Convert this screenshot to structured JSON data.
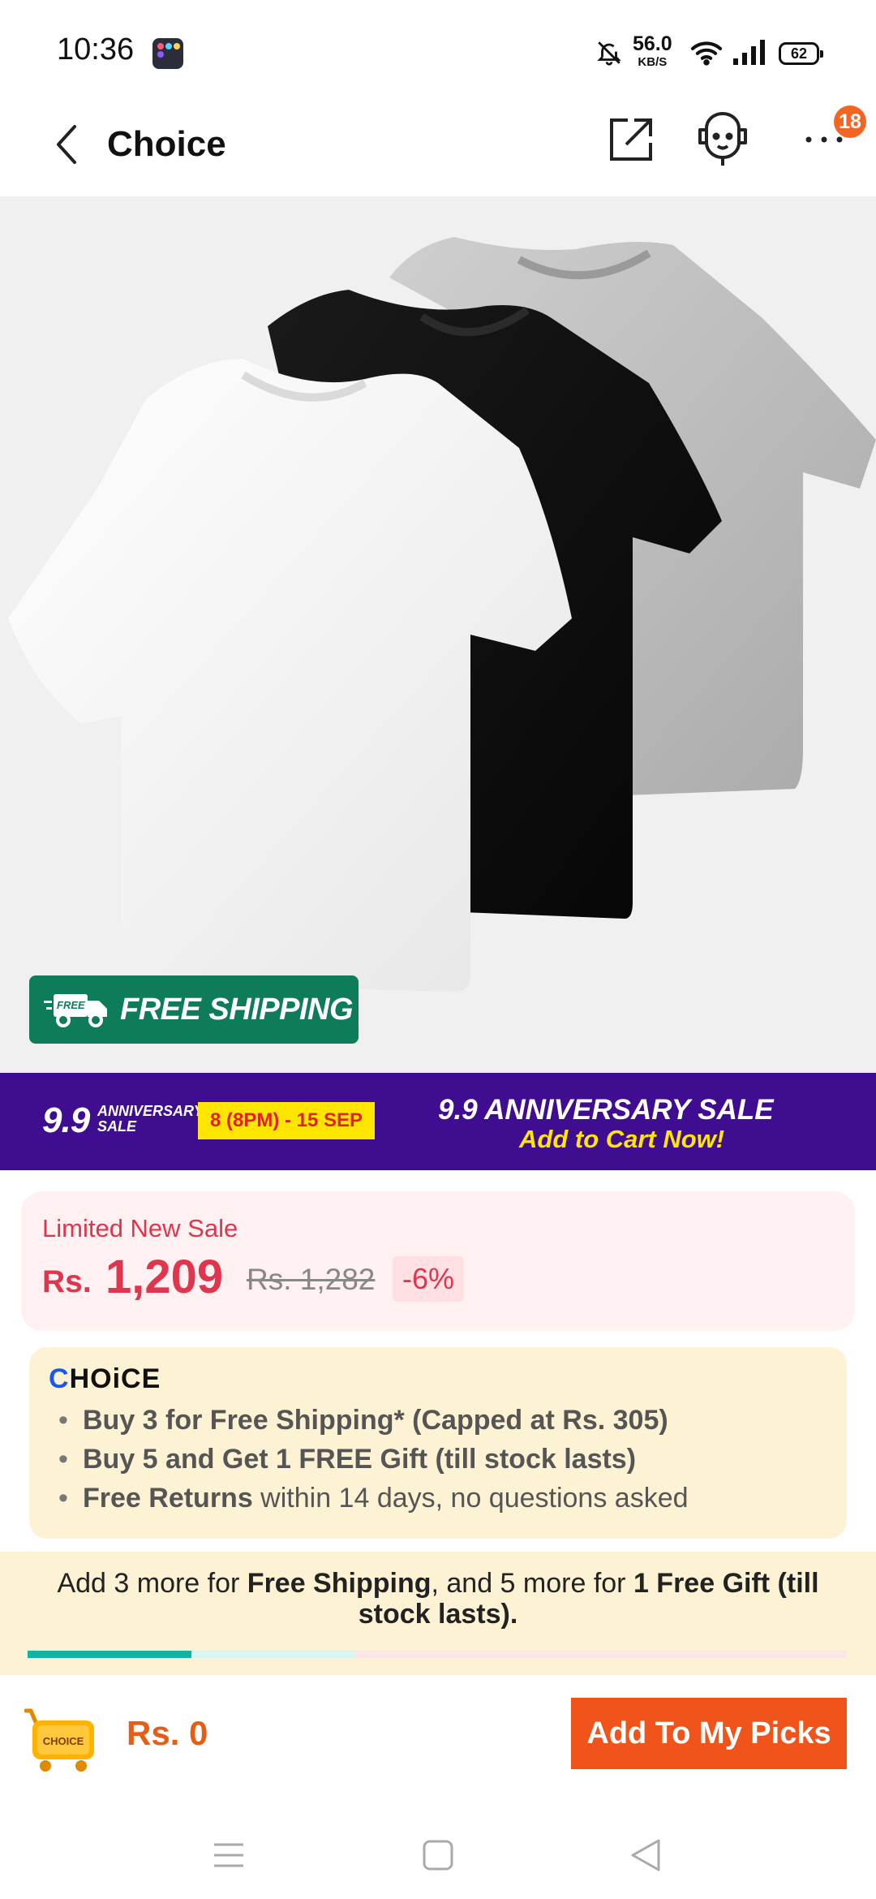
{
  "status_bar": {
    "time": "10:36",
    "net_speed_value": "56.0",
    "net_speed_unit": "KB/S",
    "battery": "62"
  },
  "header": {
    "title": "Choice",
    "notification_count": "18"
  },
  "product": {
    "free_shipping_badge": "FREE SHIPPING",
    "free_badge_small": "FREE"
  },
  "promo_banner": {
    "event_number": "9.9",
    "event_small": "ANNIVERSARY",
    "event_small_2": "SALE",
    "date_range": "8 (8PM) - 15 SEP",
    "title": "9.9 ANNIVERSARY SALE",
    "cta": "Add to Cart Now!"
  },
  "price_card": {
    "tag": "Limited New Sale",
    "currency": "Rs.",
    "price": "1,209",
    "original_price": "Rs. 1,282",
    "discount": "-6%"
  },
  "choice_card": {
    "logo": "CHOiCE",
    "benefits": [
      {
        "bold": "Buy 3 for  Free Shipping* (Capped at Rs. 305)",
        "rest": ""
      },
      {
        "bold": "Buy 5 and Get 1 FREE Gift (till stock lasts)",
        "rest": ""
      },
      {
        "bold": "Free Returns",
        "rest": " within 14 days, no questions asked"
      }
    ]
  },
  "progress": {
    "text_prefix": "Add 3 more for ",
    "text_bold1": "Free Shipping",
    "text_mid": ", and 5 more for ",
    "text_bold2": "1 Free Gift (till stock lasts).",
    "fill_fraction": 0.2
  },
  "bottom_bar": {
    "cart_label": "CHOICE",
    "total": "Rs. 0",
    "button_label": "Add To My Picks"
  },
  "colors": {
    "accent": "#f1541a",
    "price_red": "#e0364d",
    "promo_purple": "#3f0d8f",
    "shipping_green": "#0e7b5b",
    "progress_teal": "#13b3a3"
  },
  "icons": [
    "back-arrow-icon",
    "share-icon",
    "customer-service-icon",
    "more-icon",
    "delivery-truck-icon",
    "choice-cart-icon",
    "menu-nav-icon",
    "home-nav-icon",
    "back-nav-icon"
  ]
}
